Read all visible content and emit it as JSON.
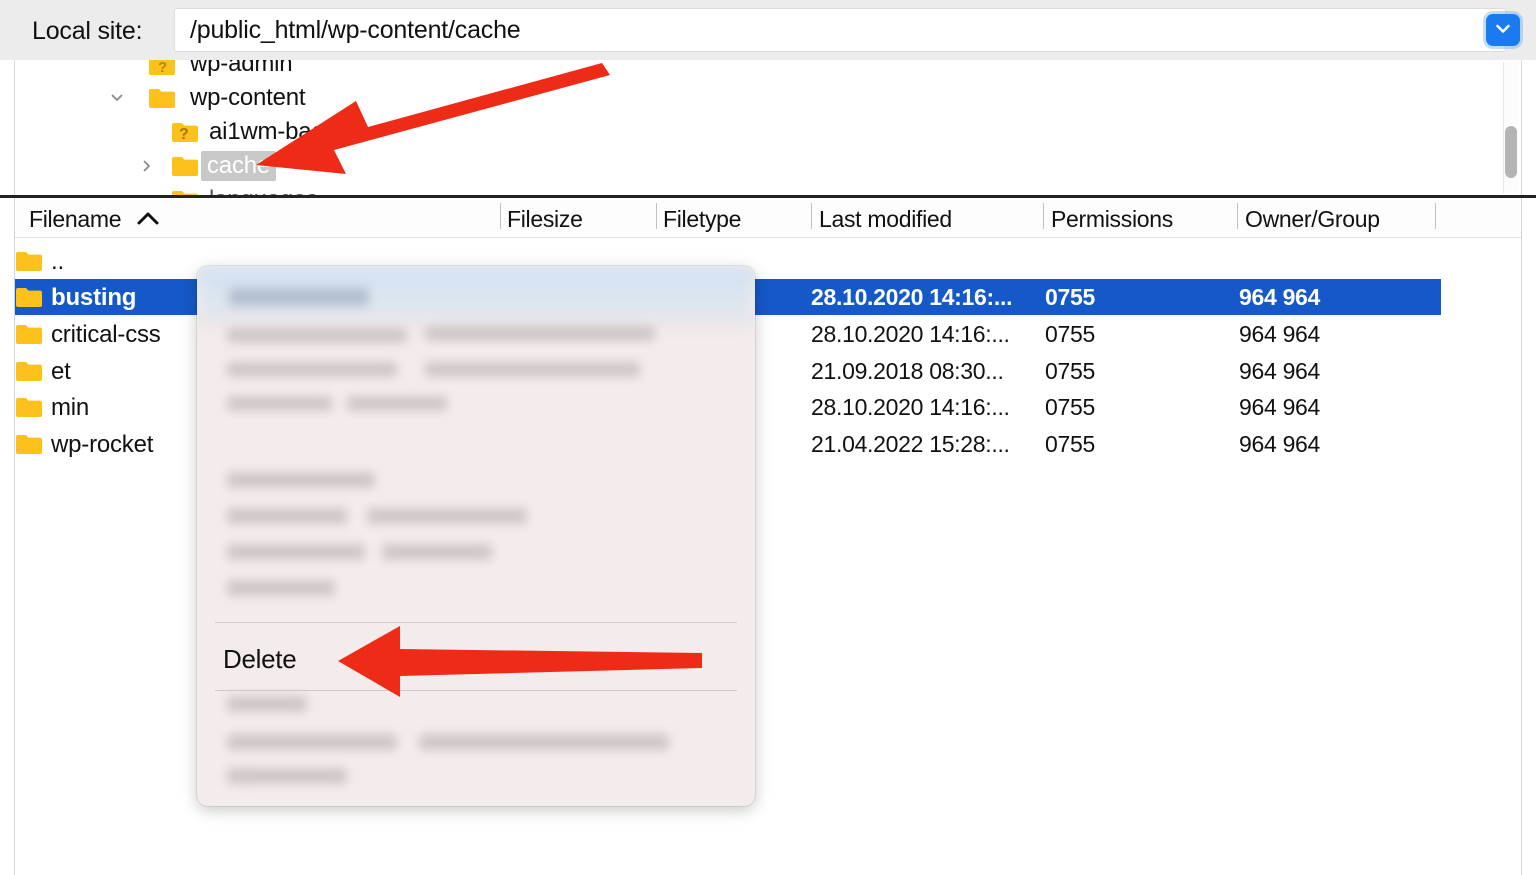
{
  "toolbar": {
    "label": "Local site:",
    "path_value": "/public_html/wp-content/cache",
    "dropdown_icon": "chevron-down-icon"
  },
  "tree": {
    "items": [
      {
        "label": "wp-admin",
        "icon": "unknown-folder-icon",
        "expander": "none",
        "selected": false,
        "clipped": "top"
      },
      {
        "label": "wp-content",
        "icon": "folder-icon",
        "expander": "chevron-down-icon",
        "selected": false
      },
      {
        "label": "ai1wm-bac",
        "icon": "unknown-folder-icon",
        "expander": "none",
        "selected": false
      },
      {
        "label": "cache",
        "icon": "folder-icon",
        "expander": "chevron-right-icon",
        "selected": true
      },
      {
        "label": "languages",
        "icon": "unknown-folder-icon",
        "expander": "none",
        "selected": false,
        "clipped": "bottom"
      }
    ]
  },
  "filelist": {
    "columns": [
      {
        "key": "filename",
        "label": "Filename",
        "sort": "ascending",
        "sort_icon": "caret-up-icon"
      },
      {
        "key": "filesize",
        "label": "Filesize"
      },
      {
        "key": "filetype",
        "label": "Filetype"
      },
      {
        "key": "modified",
        "label": "Last modified"
      },
      {
        "key": "permissions",
        "label": "Permissions"
      },
      {
        "key": "owner",
        "label": "Owner/Group"
      }
    ],
    "rows": [
      {
        "filename": "..",
        "filesize": "",
        "filetype": "",
        "modified": "",
        "permissions": "",
        "owner": "",
        "selected": false
      },
      {
        "filename": "busting",
        "filesize": "",
        "filetype": "",
        "modified": "28.10.2020 14:16:...",
        "permissions": "0755",
        "owner": "964 964",
        "selected": true
      },
      {
        "filename": "critical-css",
        "filesize": "",
        "filetype": "",
        "modified": "28.10.2020 14:16:...",
        "permissions": "0755",
        "owner": "964 964",
        "selected": false
      },
      {
        "filename": "et",
        "filesize": "",
        "filetype": "",
        "modified": "21.09.2018 08:30...",
        "permissions": "0755",
        "owner": "964 964",
        "selected": false
      },
      {
        "filename": "min",
        "filesize": "",
        "filetype": "",
        "modified": "28.10.2020 14:16:...",
        "permissions": "0755",
        "owner": "964 964",
        "selected": false
      },
      {
        "filename": "wp-rocket",
        "filesize": "",
        "filetype": "",
        "modified": "21.04.2022 15:28:...",
        "permissions": "0755",
        "owner": "964 964",
        "selected": false
      }
    ]
  },
  "context_menu": {
    "delete_label": "Delete",
    "obscured_note": "blurred menu items"
  },
  "annotations": {
    "arrow_color": "#ee2B16",
    "arrows": [
      {
        "name": "arrow-to-cache-folder",
        "points_to": "cache"
      },
      {
        "name": "arrow-to-delete-item",
        "points_to": "Delete"
      }
    ]
  },
  "colors": {
    "selection_blue": "#1558c8",
    "accent_blue": "#1a7aef",
    "folder_yellow": "#fcc21b",
    "arrow_red": "#ee2B16"
  }
}
